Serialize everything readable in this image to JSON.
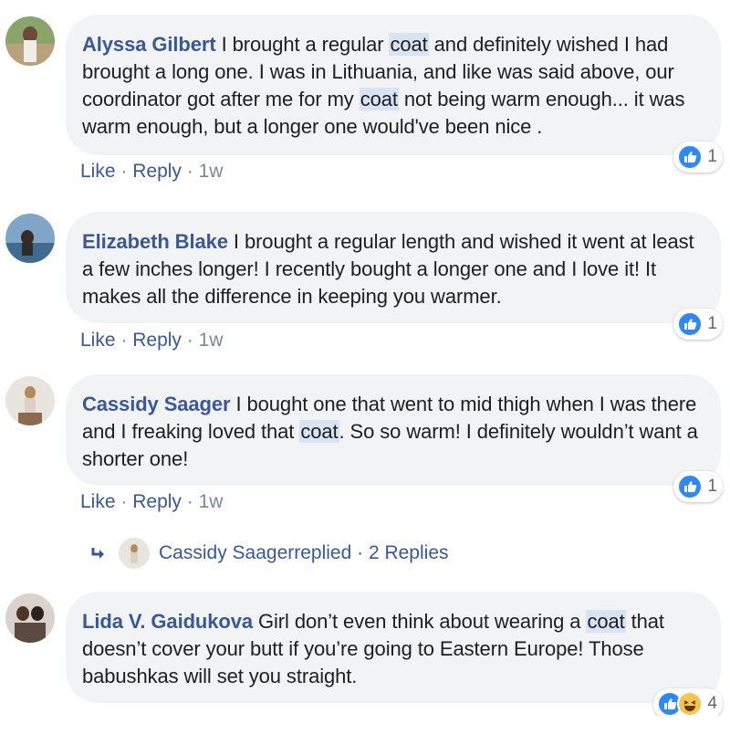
{
  "comments": [
    {
      "author": "Alyssa Gilbert",
      "text_parts": [
        " I brought a regular ",
        "coat",
        " and definitely wished I had brought a long one. I was in Lithuania, and like was said above, our coordinator got after me for my ",
        "coat",
        " not being warm enough... it was warm enough, but a longer one would've been nice ."
      ],
      "reaction_count": "1",
      "like_label": "Like",
      "reply_label": "Reply",
      "time": "1w",
      "sep": "·"
    },
    {
      "author": "Elizabeth Blake",
      "text_parts": [
        " I brought a regular length and wished it went at least a few inches longer! I recently bought a longer one and I love it! It makes all the difference in keeping you warmer."
      ],
      "reaction_count": "1",
      "like_label": "Like",
      "reply_label": "Reply",
      "time": "1w",
      "sep": "·"
    },
    {
      "author": "Cassidy Saager",
      "text_parts": [
        " I bought one that went to mid thigh when I was there and I freaking loved that ",
        "coat",
        ". So so warm! I definitely wouldn’t want a shorter one!"
      ],
      "reaction_count": "1",
      "like_label": "Like",
      "reply_label": "Reply",
      "time": "1w",
      "sep": "·"
    },
    {
      "author": "Lida V. Gaidukova",
      "text_parts": [
        " Girl don’t even think about wearing a ",
        "coat",
        " that doesn’t cover your butt if you’re going to Eastern Europe! Those babushkas will set you straight."
      ],
      "reaction_count": "4"
    }
  ],
  "replies_link": {
    "author": "Cassidy Saager",
    "text": " replied · 2 Replies"
  },
  "colors": {
    "author": "#385898",
    "bubble": "#f2f3f5",
    "highlight": "#d8e3f4",
    "like_blue": "#2d88ff"
  },
  "icons": [
    "like-reaction-icon",
    "haha-reaction-icon",
    "reply-arrow-icon"
  ]
}
